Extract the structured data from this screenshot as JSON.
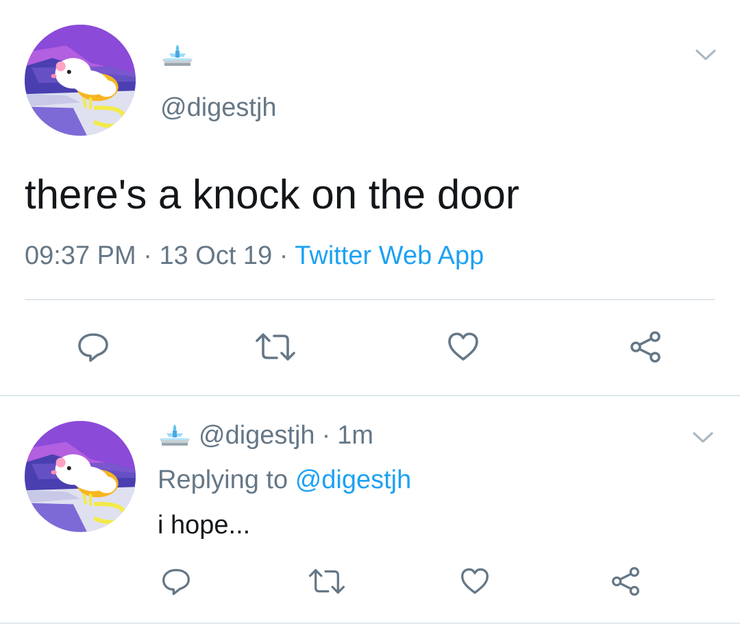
{
  "colors": {
    "text": "#14171a",
    "muted": "#657786",
    "link": "#1da1f2",
    "divider": "#e1e8ed"
  },
  "main_tweet": {
    "display_name_icon": "fountain-emoji",
    "handle": "@digestjh",
    "text": "there's a knock on the door",
    "time": "09:37 PM",
    "sep1": "·",
    "date": "13 Oct 19",
    "sep2": "·",
    "source": "Twitter Web App",
    "actions": [
      "reply-icon",
      "retweet-icon",
      "like-icon",
      "share-icon"
    ]
  },
  "reply_tweet": {
    "display_name_icon": "fountain-emoji",
    "handle": "@digestjh",
    "sep": "·",
    "time": "1m",
    "replying_to_label": "Replying to",
    "replying_to_handle": "@digestjh",
    "text": "i hope...",
    "actions": [
      "reply-icon",
      "retweet-icon",
      "like-icon",
      "share-icon"
    ]
  }
}
